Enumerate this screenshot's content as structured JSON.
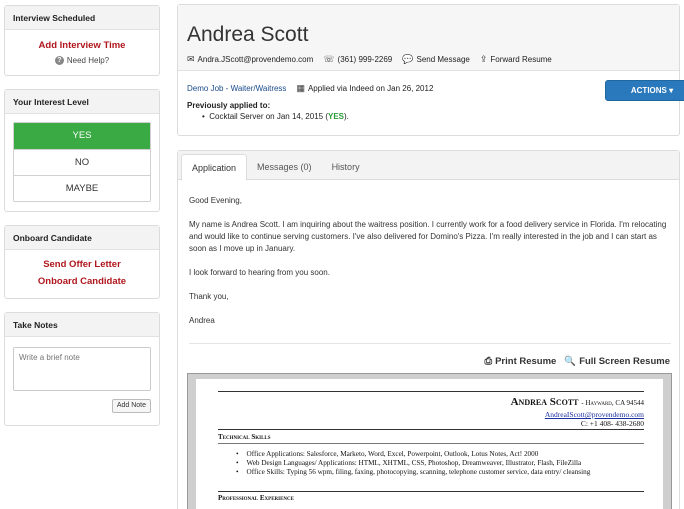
{
  "interview": {
    "heading": "Interview Scheduled",
    "add_link": "Add Interview Time",
    "help": "Need Help?"
  },
  "interest": {
    "heading": "Your Interest Level",
    "options": [
      "YES",
      "NO",
      "MAYBE"
    ],
    "selected": "YES"
  },
  "onboard": {
    "heading": "Onboard Candidate",
    "send_offer": "Send Offer Letter",
    "onboard_link": "Onboard Candidate"
  },
  "notes": {
    "heading": "Take Notes",
    "placeholder": "Write a brief note",
    "add_button": "Add Note"
  },
  "candidate": {
    "name": "Andrea Scott",
    "email": "Andra.JScott@provendemo.com",
    "phone": "(361) 999-2269",
    "send_message": "Send Message",
    "forward_resume": "Forward Resume",
    "job": "Demo Job - Waiter/Waitress",
    "applied": "Applied via Indeed on Jan 26, 2012",
    "previously_label": "Previously applied to:",
    "previous_job": "Cocktail Server on Jan 14, 2015",
    "previous_status": "YES",
    "actions_button": "ACTIONS ▾"
  },
  "tabs": [
    "Application",
    "Messages (0)",
    "History"
  ],
  "letter": {
    "greeting": "Good Evening,",
    "body": "My name is Andrea Scott. I am inquiring about the waitress position. I currently work for a food delivery service in Florida. I'm relocating and would like to continue serving customers. I've also delivered for Domino's Pizza. I'm really interested in the job and I can start as soon as I move up in January.",
    "closing_line": "I look forward to hearing from you soon.",
    "thanks": "Thank you,",
    "signature": "Andrea"
  },
  "resume_actions": {
    "print": "Print Resume",
    "fullscreen": "Full Screen Resume"
  },
  "resume": {
    "name": "Andrea Scott",
    "location": "- Hayward, CA 94544",
    "email": "AndreaIScott@provendemo.com",
    "phone": "C: +1 408- 438-2680",
    "tech_heading": "Technical Skills",
    "skills": [
      "Office Applications: Salesforce, Marketo, Word, Excel, Powerpoint, Outlook, Lotus Notes, Act! 2000",
      "Web Design Languages/ Applications: HTML, XHTML, CSS, Photoshop, Dreamweaver, Illustrator, Flash, FileZilla",
      "Office Skills: Typing 56 wpm, filing, faxing, photocopying, scanning, telephone customer service, data entry/ cleansing"
    ],
    "exp_heading": "Professional Experience"
  },
  "colors": {
    "accent_red": "#b0161c",
    "yes_green": "#3aaa45",
    "actions_blue": "#2a79bd"
  }
}
